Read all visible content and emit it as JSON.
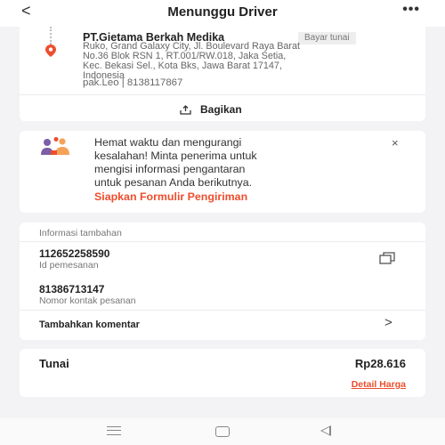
{
  "header": {
    "back_glyph": "<",
    "title": "Menunggu Driver",
    "more_glyph": "•••"
  },
  "address": {
    "name": "PT.Gietama Berkah Medika",
    "badge": "Bayar tunai",
    "lines": [
      "Ruko, Grand Galaxy City, Jl. Boulevard Raya Barat",
      "No.36 Blok RSN 1, RT.001/RW.018, Jaka Setia,",
      "Kec. Bekasi Sel., Kota Bks, Jawa Barat 17147,",
      "Indonesia"
    ],
    "contact": "pak.Leo | 8138117867",
    "share_label": "Bagikan"
  },
  "tip": {
    "lines": [
      "Hemat waktu dan mengurangi",
      "kesalahan! Minta penerima untuk",
      "mengisi informasi pengantaran",
      "untuk pesanan Anda berikutnya."
    ],
    "close_glyph": "×",
    "link": "Siapkan Formulir Pengiriman"
  },
  "info": {
    "header": "Informasi tambahan",
    "order_id": "112652258590",
    "order_id_label": "Id pemesanan",
    "contact_number": "81386713147",
    "contact_number_label": "Nomor kontak pesanan",
    "comment_label": "Tambahkan komentar",
    "chevron_glyph": ">"
  },
  "payment": {
    "method": "Tunai",
    "amount": "Rp28.616",
    "detail_link": "Detail Harga"
  },
  "colors": {
    "accent": "#ee4d2d",
    "background": "#f3f3f5",
    "card": "#ffffff"
  },
  "icons": {
    "back": "back-arrow-icon",
    "more": "more-dots-icon",
    "pin": "location-pin-icon",
    "share": "share-icon",
    "tip": "people-illustration-icon",
    "close": "close-icon",
    "copy": "copy-icon",
    "chevron": "chevron-right-icon",
    "nav_menu": "recent-apps-icon",
    "nav_home": "home-icon",
    "nav_back": "nav-back-icon"
  }
}
